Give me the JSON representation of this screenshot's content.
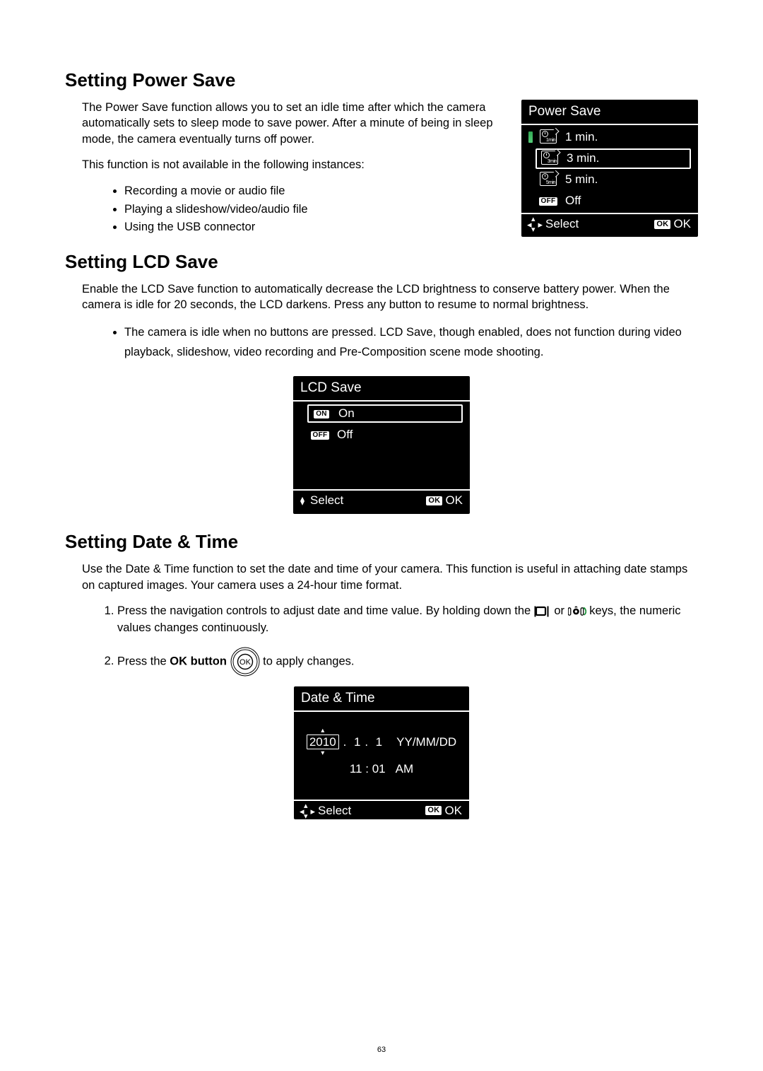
{
  "page_number": "63",
  "powerSave": {
    "heading": "Setting Power Save",
    "paragraph": "The Power Save function allows you to set an idle time after which the camera automatically sets to sleep mode to save power. After a minute of being in sleep mode, the camera eventually turns off power.",
    "unavail_intro": "This function is not available in the following instances:",
    "unavail_items": [
      "Recording a movie or audio file",
      "Playing a slideshow/video/audio file",
      "Using the USB connector"
    ],
    "lcd": {
      "title": "Power Save",
      "options": [
        {
          "icon": "1min",
          "label": "1 min."
        },
        {
          "icon": "3min",
          "label": "3 min."
        },
        {
          "icon": "5min",
          "label": "5 min."
        },
        {
          "icon": "OFF",
          "label": "Off"
        }
      ],
      "selected_index": 1,
      "marked_index": 0,
      "footer_select": "Select",
      "footer_ok": "OK"
    }
  },
  "lcdSave": {
    "heading": "Setting LCD Save",
    "paragraph": "Enable the LCD Save function to automatically decrease the LCD brightness to conserve battery power. When the camera is idle for 20 seconds, the LCD darkens. Press any button to resume to normal brightness.",
    "note": "The camera is idle when no buttons are pressed. LCD Save, though enabled, does not function during video playback, slideshow, video recording and Pre-Composition scene mode shooting.",
    "lcd": {
      "title": "LCD Save",
      "options": [
        {
          "icon": "ON",
          "label": "On"
        },
        {
          "icon": "OFF",
          "label": "Off"
        }
      ],
      "selected_index": 0,
      "footer_select": "Select",
      "footer_ok": "OK"
    }
  },
  "dateTime": {
    "heading": "Setting Date & Time",
    "paragraph": "Use the Date & Time function to set the date and time of your camera. This function is useful in attaching date stamps on captured images. Your camera uses a 24-hour time format.",
    "step1_a": "Press the navigation controls to adjust date and time value. By holding down the ",
    "step1_b": " or ",
    "step1_c": " keys, the numeric values changes continuously.",
    "step2_a": "Press the ",
    "step2_bold": "OK button",
    "step2_b": " to apply changes.",
    "okCircleLabel": "OK",
    "lcd": {
      "title": "Date & Time",
      "year": "2010",
      "month": "1",
      "day": "1",
      "format": "YY/MM/DD",
      "hour": "11",
      "minute": "01",
      "ampm": "AM",
      "footer_select": "Select",
      "footer_ok": "OK"
    }
  }
}
